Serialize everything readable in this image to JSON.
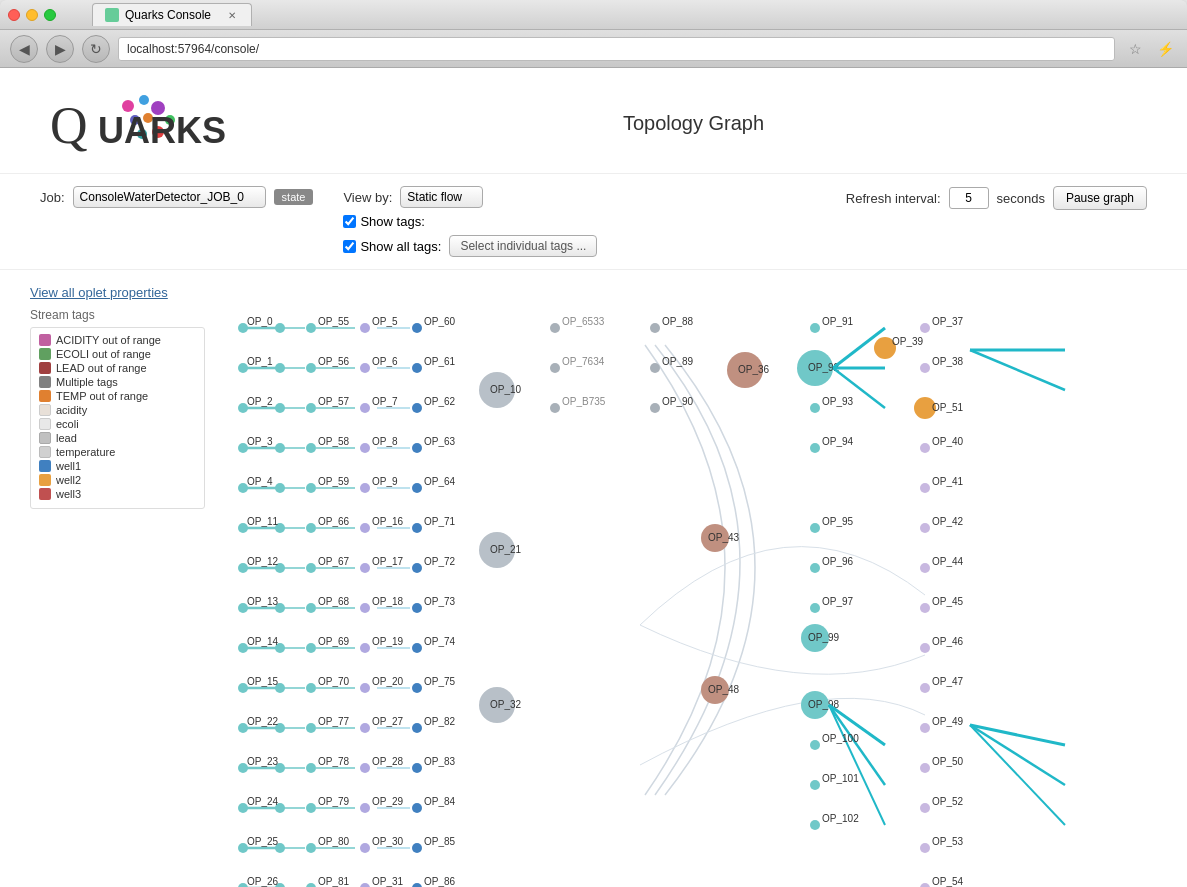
{
  "browser": {
    "tab_title": "Quarks Console",
    "url": "localhost:57964/console/",
    "back_icon": "◀",
    "forward_icon": "▶",
    "refresh_icon": "↻"
  },
  "page": {
    "title": "Topology Graph",
    "logo_text": "QUARKS"
  },
  "controls": {
    "job_label": "Job:",
    "job_value": "ConsoleWaterDetector_JOB_0",
    "state_badge": "state",
    "view_by_label": "View by:",
    "view_by_value": "Static flow",
    "show_tags_label": "Show tags:",
    "show_all_tags_label": "Show all tags:",
    "select_tags_btn": "Select individual tags ...",
    "refresh_label": "Refresh interval:",
    "refresh_value": "5",
    "seconds_label": "seconds",
    "pause_btn": "Pause graph"
  },
  "sidebar": {
    "view_oplet_link": "View all oplet properties",
    "stream_tags_label": "Stream tags",
    "legend": [
      {
        "color": "#c060a0",
        "label": "ACIDITY out of range"
      },
      {
        "color": "#60a060",
        "label": "ECOLI out of range"
      },
      {
        "color": "#a04040",
        "label": "LEAD out of range"
      },
      {
        "color": "#808080",
        "label": "Multiple tags"
      },
      {
        "color": "#e08030",
        "label": "TEMP out of range"
      },
      {
        "color": "#e8e8e8",
        "label": "acidity"
      },
      {
        "color": "#e8e8e8",
        "label": "ecoli"
      },
      {
        "color": "#c8c8c8",
        "label": "lead"
      },
      {
        "color": "#d8d8d8",
        "label": "temperature"
      },
      {
        "color": "#4080c0",
        "label": "well1"
      },
      {
        "color": "#e8a040",
        "label": "well2"
      },
      {
        "color": "#c05050",
        "label": "well3"
      }
    ]
  },
  "nodes": {
    "left_col": [
      "OP_0",
      "OP_1",
      "OP_2",
      "OP_3",
      "OP_4",
      "OP_11",
      "OP_12",
      "OP_13",
      "OP_14",
      "OP_15",
      "OP_22",
      "OP_23",
      "OP_24",
      "OP_25",
      "OP_26"
    ],
    "col2": [
      "OP_55",
      "OP_56",
      "OP_57",
      "OP_58",
      "OP_59",
      "OP_66",
      "OP_67",
      "OP_68",
      "OP_69",
      "OP_70",
      "OP_77",
      "OP_78",
      "OP_79",
      "OP_80",
      "OP_81"
    ],
    "col3": [
      "OP_5",
      "OP_6",
      "OP_7",
      "OP_8",
      "OP_9",
      "OP_16",
      "OP_17",
      "OP_18",
      "OP_19",
      "OP_20",
      "OP_27",
      "OP_28",
      "OP_29",
      "OP_30",
      "OP_31"
    ],
    "col4": [
      "OP_60",
      "OP_61",
      "OP_62",
      "OP_63",
      "OP_64",
      "OP_71",
      "OP_72",
      "OP_73",
      "OP_74",
      "OP_75",
      "OP_82",
      "OP_83",
      "OP_84",
      "OP_85",
      "OP_86"
    ],
    "col5_labels": [
      "OP_10",
      "OP_21",
      "OP_32"
    ],
    "col6": [
      "OP_6533",
      "OP_7634",
      "OP_B735"
    ],
    "col7": [
      "OP_88",
      "OP_89",
      "OP_90",
      "OP_43",
      "OP_48"
    ],
    "col8": [
      "OP_36"
    ],
    "col9": [
      "OP_91",
      "OP_92",
      "OP_93",
      "OP_94",
      "OP_95",
      "OP_96",
      "OP_97",
      "OP_99",
      "OP_98",
      "OP_100",
      "OP_101",
      "OP_102"
    ],
    "col10": [
      "OP_39",
      "OP_37",
      "OP_38",
      "OP_40",
      "OP_41",
      "OP_42",
      "OP_44",
      "OP_45",
      "OP_46",
      "OP_47",
      "OP_49",
      "OP_50",
      "OP_51",
      "OP_52",
      "OP_53",
      "OP_54"
    ]
  }
}
